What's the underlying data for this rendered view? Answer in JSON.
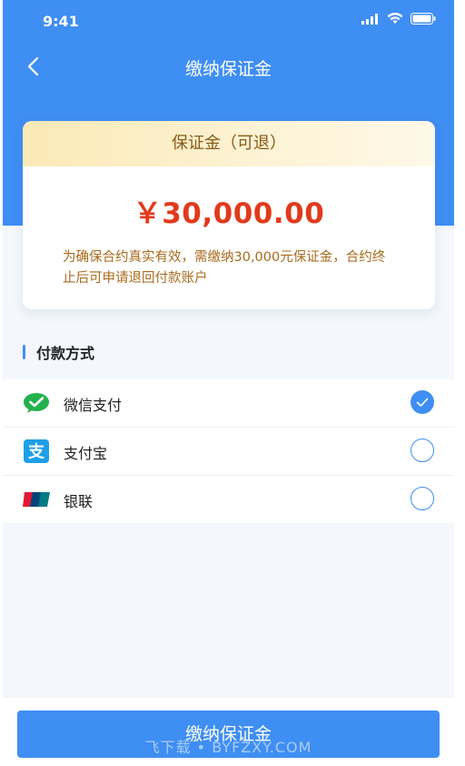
{
  "status_bar": {
    "time": "9:41"
  },
  "nav": {
    "title": "缴纳保证金"
  },
  "deposit_card": {
    "header": "保证金（可退）",
    "amount": "￥30,000.00",
    "description": "为确保合约真实有效，需缴纳30,000元保证金，合约终止后可申请退回付款账户"
  },
  "payment": {
    "section_title": "付款方式",
    "methods": [
      {
        "label": "微信支付",
        "icon": "wechat-pay-icon",
        "selected": true
      },
      {
        "label": "支付宝",
        "icon": "alipay-icon",
        "selected": false
      },
      {
        "label": "银联",
        "icon": "unionpay-icon",
        "selected": false
      }
    ]
  },
  "footer": {
    "submit_label": "缴纳保证金",
    "watermark": "飞下载 • BYFZXY.COM"
  },
  "colors": {
    "primary": "#3f8ef3",
    "amount": "#e13a1b",
    "note": "#a86a1c",
    "card_header": "#fbe9b6"
  }
}
